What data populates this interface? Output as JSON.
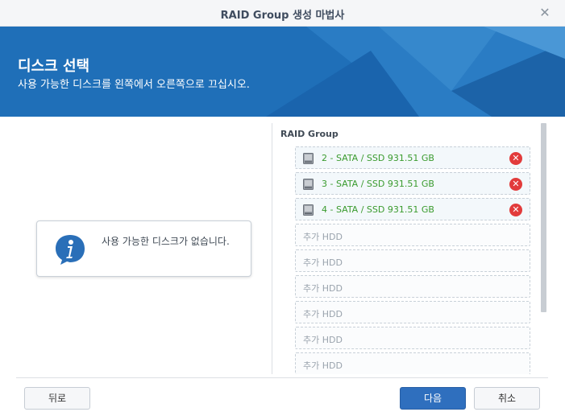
{
  "window": {
    "title": "RAID Group 생성 마법사",
    "close_icon": "close-icon"
  },
  "header": {
    "title": "디스크 선택",
    "subtitle": "사용 가능한 디스크를 왼쪽에서 오른쪽으로 끄십시오."
  },
  "available": {
    "message": "사용 가능한 디스크가 없습니다."
  },
  "raid_group": {
    "label": "RAID Group",
    "disks": [
      {
        "label": "2 - SATA / SSD 931.51 GB"
      },
      {
        "label": "3 - SATA / SSD 931.51 GB"
      },
      {
        "label": "4 - SATA / SSD 931.51 GB"
      }
    ],
    "empty_slots": [
      {
        "label": "추가 HDD"
      },
      {
        "label": "추가 HDD"
      },
      {
        "label": "추가 HDD"
      },
      {
        "label": "추가 HDD"
      },
      {
        "label": "추가 HDD"
      },
      {
        "label": "추가 HDD"
      }
    ]
  },
  "footer": {
    "back": "뒤로",
    "next": "다음",
    "cancel": "취소"
  },
  "colors": {
    "banner": "#1f6fb8",
    "disk_text": "#3a9b2e",
    "remove": "#e23b3b",
    "primary_button": "#2f6fbe"
  }
}
